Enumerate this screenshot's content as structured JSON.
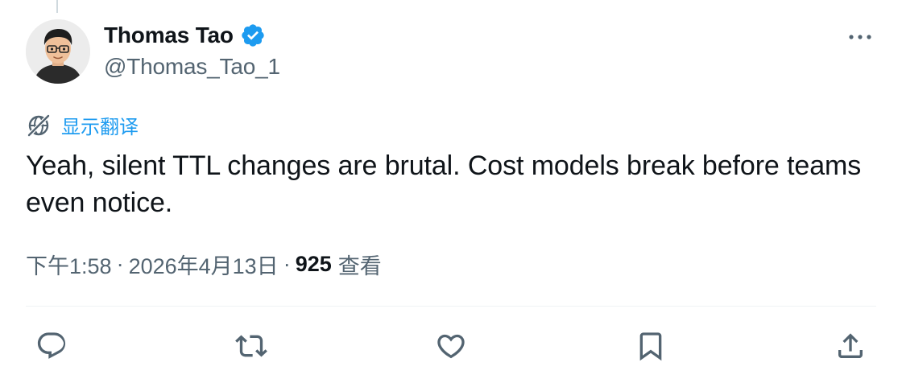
{
  "author": {
    "display_name": "Thomas Tao",
    "handle": "@Thomas_Tao_1",
    "verified": true,
    "avatar_icon": "avatar-illustration-icon"
  },
  "menu": {
    "icon": "more-icon"
  },
  "translate": {
    "label": "显示翻译",
    "icon": "translate-globe-icon"
  },
  "tweet": {
    "text": "Yeah, silent TTL changes are brutal. Cost models break before teams even notice."
  },
  "meta": {
    "time": "下午1:58",
    "separator": "·",
    "date": "2026年4月13日",
    "views_count": "925",
    "views_label": "查看"
  },
  "actions": [
    {
      "name": "reply",
      "icon": "reply-icon"
    },
    {
      "name": "retweet",
      "icon": "retweet-icon"
    },
    {
      "name": "like",
      "icon": "heart-icon"
    },
    {
      "name": "bookmark",
      "icon": "bookmark-icon"
    },
    {
      "name": "share",
      "icon": "share-icon"
    }
  ],
  "colors": {
    "accent": "#1d9bf0",
    "text_primary": "#0f1419",
    "text_secondary": "#536471",
    "divider": "#eff3f4"
  }
}
